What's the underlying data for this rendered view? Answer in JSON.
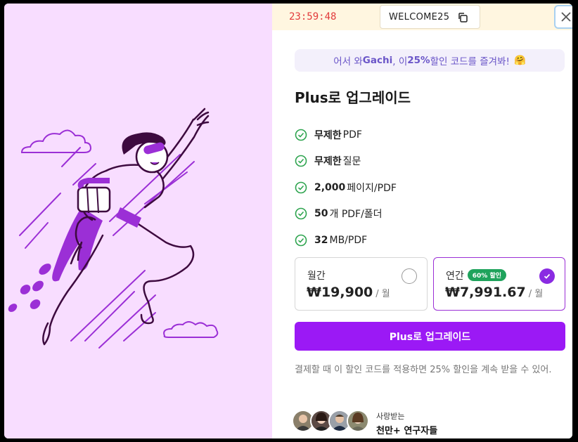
{
  "promo": {
    "timer": "23:59:48",
    "coupon_code": "WELCOME25"
  },
  "greeting": {
    "prefix": "어서 와 ",
    "name": "Gachi",
    "middle": ", 이 ",
    "percent": "25%",
    "suffix": " 할인 코드를 즐겨봐!",
    "emoji": "🤗"
  },
  "title": "Plus로 업그레이드",
  "features": [
    {
      "bold": "무제한",
      "text": " PDF"
    },
    {
      "bold": "무제한",
      "text": " 질문"
    },
    {
      "bold": "2,000",
      "text": "페이지/PDF"
    },
    {
      "bold": "50",
      "text": "개 PDF/폴더"
    },
    {
      "bold": "32",
      "text": " MB/PDF"
    }
  ],
  "plans": {
    "monthly": {
      "name": "월간",
      "price": "₩19,900",
      "unit": "/ 월",
      "selected": false
    },
    "yearly": {
      "name": "연간",
      "badge": "60% 할인",
      "price": "₩7,991.67",
      "unit": "/ 월",
      "selected": true
    }
  },
  "cta_label": "Plus로 업그레이드",
  "note": "결제할 때 이 할인 코드를 적용하면 25% 할인을 계속 받을 수 있어.",
  "social": {
    "top": "사랑받는",
    "bottom": "천만+ 연구자들"
  },
  "colors": {
    "accent": "#9b19f5",
    "illustration_bg": "#f8ddff",
    "timer": "#e23b3b",
    "check": "#2ea44f"
  },
  "icons": [
    "copy-icon",
    "close-icon",
    "check-circle-icon",
    "radio-check-icon"
  ]
}
